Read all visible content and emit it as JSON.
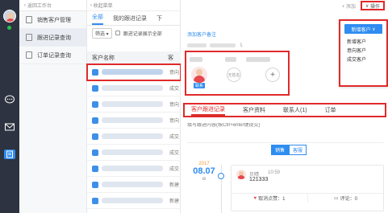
{
  "rail": {
    "icons": [
      "chat-icon",
      "mail-icon",
      "crm-icon"
    ]
  },
  "sidebar": {
    "back_label": "返回工作台",
    "items": [
      {
        "label": "销售客户管理",
        "active": false
      },
      {
        "label": "跟进记录查询",
        "active": true
      },
      {
        "label": "订单记录查询",
        "active": false
      }
    ]
  },
  "list": {
    "collapse_label": "收起菜单",
    "tabs": [
      "全部",
      "我的跟进记录",
      "下"
    ],
    "filter_label": "筛选",
    "show_all_label": "跟进记录展示全部",
    "col_name": "客户名称",
    "col_status": "客",
    "rows": [
      {
        "status": "意向",
        "highlight": true
      },
      {
        "status": "成交",
        "highlight": false
      },
      {
        "status": "意向",
        "highlight": false
      },
      {
        "status": "意向",
        "highlight": false
      },
      {
        "status": "成交",
        "highlight": false
      },
      {
        "status": "成交",
        "highlight": false
      },
      {
        "status": "成交",
        "highlight": false
      },
      {
        "status": "新建",
        "highlight": false
      },
      {
        "status": "新建",
        "highlight": false
      }
    ]
  },
  "detail": {
    "add_label": "+ 添加",
    "op_label": "操作",
    "add_note": "添加客户备注",
    "phone_suffix": "ｌ",
    "card_tag": "联系",
    "ring_text": "无姓名",
    "ring_plus": "+",
    "tabs": [
      "客户跟进记录",
      "客户资料",
      "联系人(1)",
      "订单"
    ],
    "composer_placeholder": "填写跟进内容(按Ctrl+enter键提交)",
    "seg": [
      "销售",
      "客服"
    ],
    "date": {
      "year": "2017",
      "md": "08.07",
      "next": "⊖"
    },
    "entry": {
      "name": "贝晴",
      "time": "10:59",
      "text": "121333",
      "like_label": "取消点赞：1",
      "comment_label": "评论：0"
    }
  },
  "dropdown": {
    "head": "新增客户",
    "options": [
      "新增客户",
      "意向客户",
      "成交客户"
    ]
  },
  "colors": {
    "accent": "#2f8cf0",
    "highlight": "#e02a2a",
    "rail": "#2d3340"
  }
}
